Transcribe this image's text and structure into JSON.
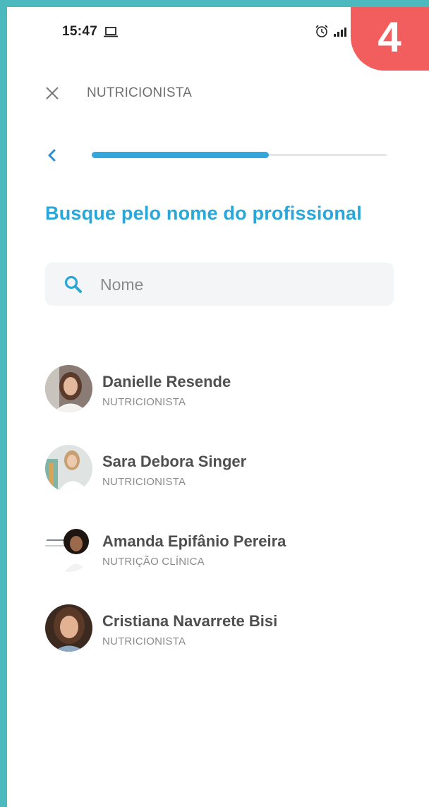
{
  "status_bar": {
    "time": "15:47",
    "icons": [
      "laptop-icon",
      "alarm-icon",
      "signal-icon"
    ]
  },
  "badge": {
    "number": "4",
    "color": "#f25e5e"
  },
  "header": {
    "title": "NUTRICIONISTA",
    "close_icon": "close-icon"
  },
  "progress": {
    "value": 0.6,
    "back_icon": "chevron-left-icon",
    "color": "#35a6db"
  },
  "heading": "Busque pelo nome do profissional",
  "search": {
    "placeholder": "Nome",
    "value": "",
    "icon": "search-icon"
  },
  "professionals": [
    {
      "name": "Danielle Resende",
      "specialty": "NUTRICIONISTA"
    },
    {
      "name": "Sara Debora Singer",
      "specialty": "NUTRICIONISTA"
    },
    {
      "name": "Amanda Epifânio Pereira",
      "specialty": "NUTRIÇÃO CLÍNICA"
    },
    {
      "name": "Cristiana Navarrete Bisi",
      "specialty": "NUTRICIONISTA"
    }
  ],
  "colors": {
    "accent": "#2aa7d9",
    "frame": "#4bb9bd",
    "text": "#4f4f4f"
  }
}
